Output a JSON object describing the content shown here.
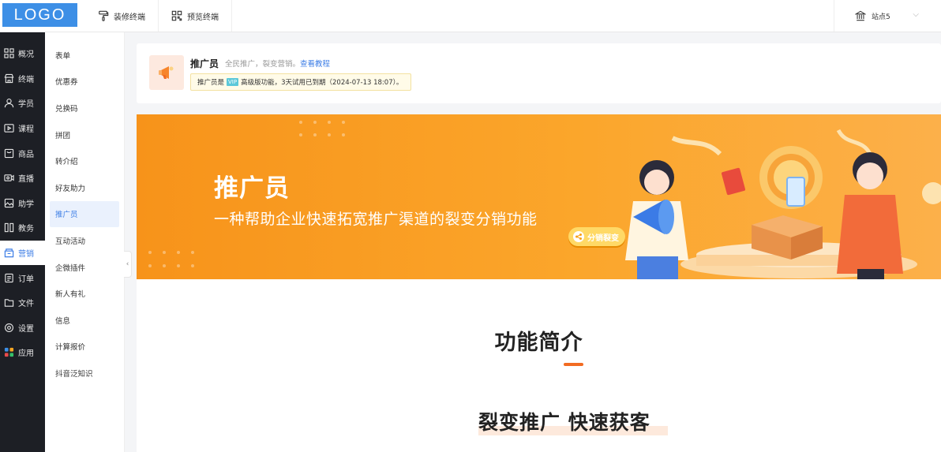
{
  "header": {
    "logo": "LOGO",
    "tabs": [
      {
        "label": "装修终端",
        "icon": "paint-roller-icon"
      },
      {
        "label": "预览终端",
        "icon": "qr-code-icon"
      }
    ],
    "site": {
      "label": "站点5",
      "icon": "bank-icon"
    }
  },
  "sidebar": {
    "items": [
      {
        "label": "概况",
        "icon": "grid-icon"
      },
      {
        "label": "终端",
        "icon": "store-icon"
      },
      {
        "label": "学员",
        "icon": "users-icon"
      },
      {
        "label": "课程",
        "icon": "play-icon"
      },
      {
        "label": "商品",
        "icon": "bag-icon"
      },
      {
        "label": "直播",
        "icon": "camera-icon"
      },
      {
        "label": "助学",
        "icon": "image-icon"
      },
      {
        "label": "教务",
        "icon": "book-icon"
      },
      {
        "label": "营销",
        "icon": "marketing-icon"
      },
      {
        "label": "订单",
        "icon": "order-icon"
      },
      {
        "label": "文件",
        "icon": "folder-icon"
      },
      {
        "label": "设置",
        "icon": "gear-icon"
      },
      {
        "label": "应用",
        "icon": "apps-icon"
      }
    ],
    "active": "营销"
  },
  "subnav": {
    "items": [
      "表单",
      "优惠券",
      "兑换码",
      "拼团",
      "转介绍",
      "好友助力",
      "推广员",
      "互动活动",
      "企微插件",
      "新人有礼",
      "信息",
      "计算报价",
      "抖音泛知识"
    ],
    "active": "推广员"
  },
  "info": {
    "title": "推广员",
    "subtitle": "全民推广，裂变营销。",
    "link": "查看教程",
    "notice_prefix": "推广员是",
    "badge": "VIP",
    "notice_suffix": "高级版功能，3天试用已到期（2024-07-13 18:07）。"
  },
  "banner": {
    "title": "推广员",
    "subtitle": "一种帮助企业快速拓宽推广渠道的裂变分销功能",
    "badge": "分销裂变"
  },
  "content": {
    "section_title": "功能简介",
    "slogan": "裂变推广  快速获客"
  },
  "colors": {
    "accent": "#3d7ee6",
    "banner": "#f7931a",
    "sidebar_bg": "#1d1f25"
  }
}
